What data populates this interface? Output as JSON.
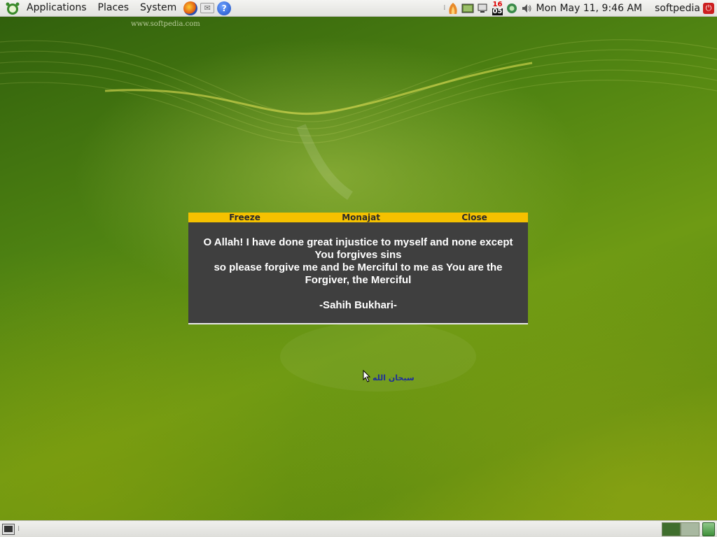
{
  "top_panel": {
    "menus": [
      "Applications",
      "Places",
      "System"
    ],
    "launchers": [
      {
        "name": "firefox-icon",
        "glyph": ""
      },
      {
        "name": "mail-icon",
        "glyph": "✉"
      },
      {
        "name": "help-icon",
        "glyph": "?"
      }
    ],
    "calendar_icon": {
      "top": "16",
      "bottom": "05"
    },
    "clock": "Mon May 11,  9:46 AM",
    "user": "softpedia"
  },
  "desktop": {
    "watermark_url": "www.softpedia.com",
    "arabic_label": "سبحان الله"
  },
  "dialog": {
    "buttons": {
      "freeze": "Freeze",
      "title": "Monajat",
      "close": "Close"
    },
    "text_line1": "O Allah! I have done great injustice to myself and none except You forgives sins",
    "text_line2": "so please forgive me and be Merciful to me as You are the Forgiver, the Merciful",
    "source": "-Sahih Bukhari-"
  },
  "colors": {
    "dialog_bar": "#f5c100",
    "dialog_bg": "#3f3f3f",
    "desktop_green": "#4f8312"
  },
  "bottom_panel": {
    "workspaces": 2,
    "active_workspace": 1
  }
}
